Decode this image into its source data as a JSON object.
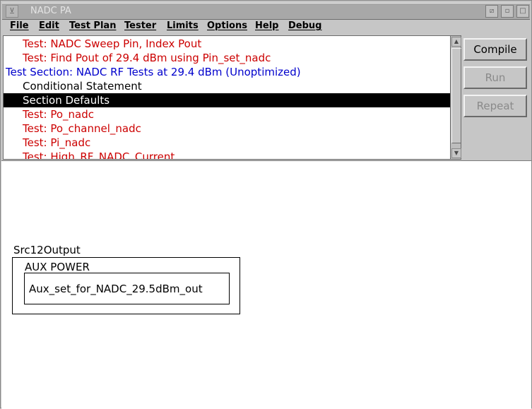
{
  "window": {
    "title": "NADC PA",
    "icon": "window-menu-icon",
    "controls": [
      "minimize-icon",
      "restore-icon",
      "close-icon"
    ]
  },
  "menu": [
    "File",
    "Edit",
    "Test Plan",
    "Tester",
    "Limits",
    "Options",
    "Help",
    "Debug"
  ],
  "test_list": {
    "rows": [
      {
        "text": "Test: NADC Sweep Pin, Index Pout",
        "color": "#cc0000",
        "indent": 1
      },
      {
        "text": "Test: Find Pout of 29.4 dBm using Pin_set_nadc",
        "color": "#cc0000",
        "indent": 1
      },
      {
        "text": "Test Section: NADC RF Tests at 29.4 dBm (Unoptimized)",
        "color": "#0000cc",
        "indent": 0
      },
      {
        "text": "Conditional Statement",
        "color": "#000000",
        "indent": 1
      },
      {
        "text": "Section Defaults",
        "color": "#ffffff",
        "indent": 1,
        "selected": true
      },
      {
        "text": "Test: Po_nadc",
        "color": "#cc0000",
        "indent": 1
      },
      {
        "text": "Test: Po_channel_nadc",
        "color": "#cc0000",
        "indent": 1
      },
      {
        "text": "Test: Pi_nadc",
        "color": "#cc0000",
        "indent": 1
      },
      {
        "text": "Test: High_RF_NADC_Current",
        "color": "#cc0000",
        "indent": 1
      }
    ]
  },
  "buttons": {
    "compile": "Compile",
    "run": "Run",
    "repeat": "Repeat"
  },
  "diagram": {
    "label": "Src12Output",
    "block_title": "AUX POWER",
    "block_item": "Aux_set_for_NADC_29.5dBm_out"
  }
}
